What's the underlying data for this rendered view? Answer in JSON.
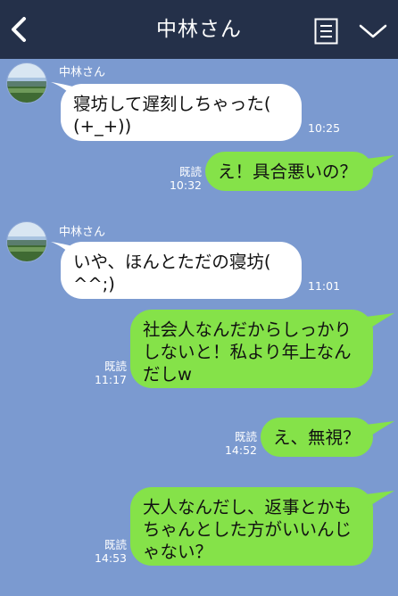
{
  "header": {
    "title": "中林さん"
  },
  "messages": [
    {
      "sender": "中林さん",
      "text_lines": [
        "寝坊して遅刻しちゃった(",
        "(+_+))"
      ],
      "time": "10:25"
    },
    {
      "text_lines": [
        "え！具合悪いの？"
      ],
      "read": "既読",
      "time": "10:32"
    },
    {
      "sender": "中林さん",
      "text_lines": [
        "いや、ほんとただの寝坊(",
        "^^;)"
      ],
      "time": "11:01"
    },
    {
      "text_lines": [
        "社会人なんだからしっかり",
        "しないと！私より年上なん",
        "だしw"
      ],
      "read": "既読",
      "time": "11:17"
    },
    {
      "text_lines": [
        "え、無視？"
      ],
      "read": "既読",
      "time": "14:52"
    },
    {
      "text_lines": [
        "大人なんだし、返事とかも",
        "ちゃんとした方がいいんじ",
        "ゃない？"
      ],
      "read": "既読",
      "time": "14:53"
    }
  ],
  "colors": {
    "background": "#7b9ad0",
    "header": "#243049",
    "incoming_bubble": "#ffffff",
    "outgoing_bubble": "#85e249"
  }
}
